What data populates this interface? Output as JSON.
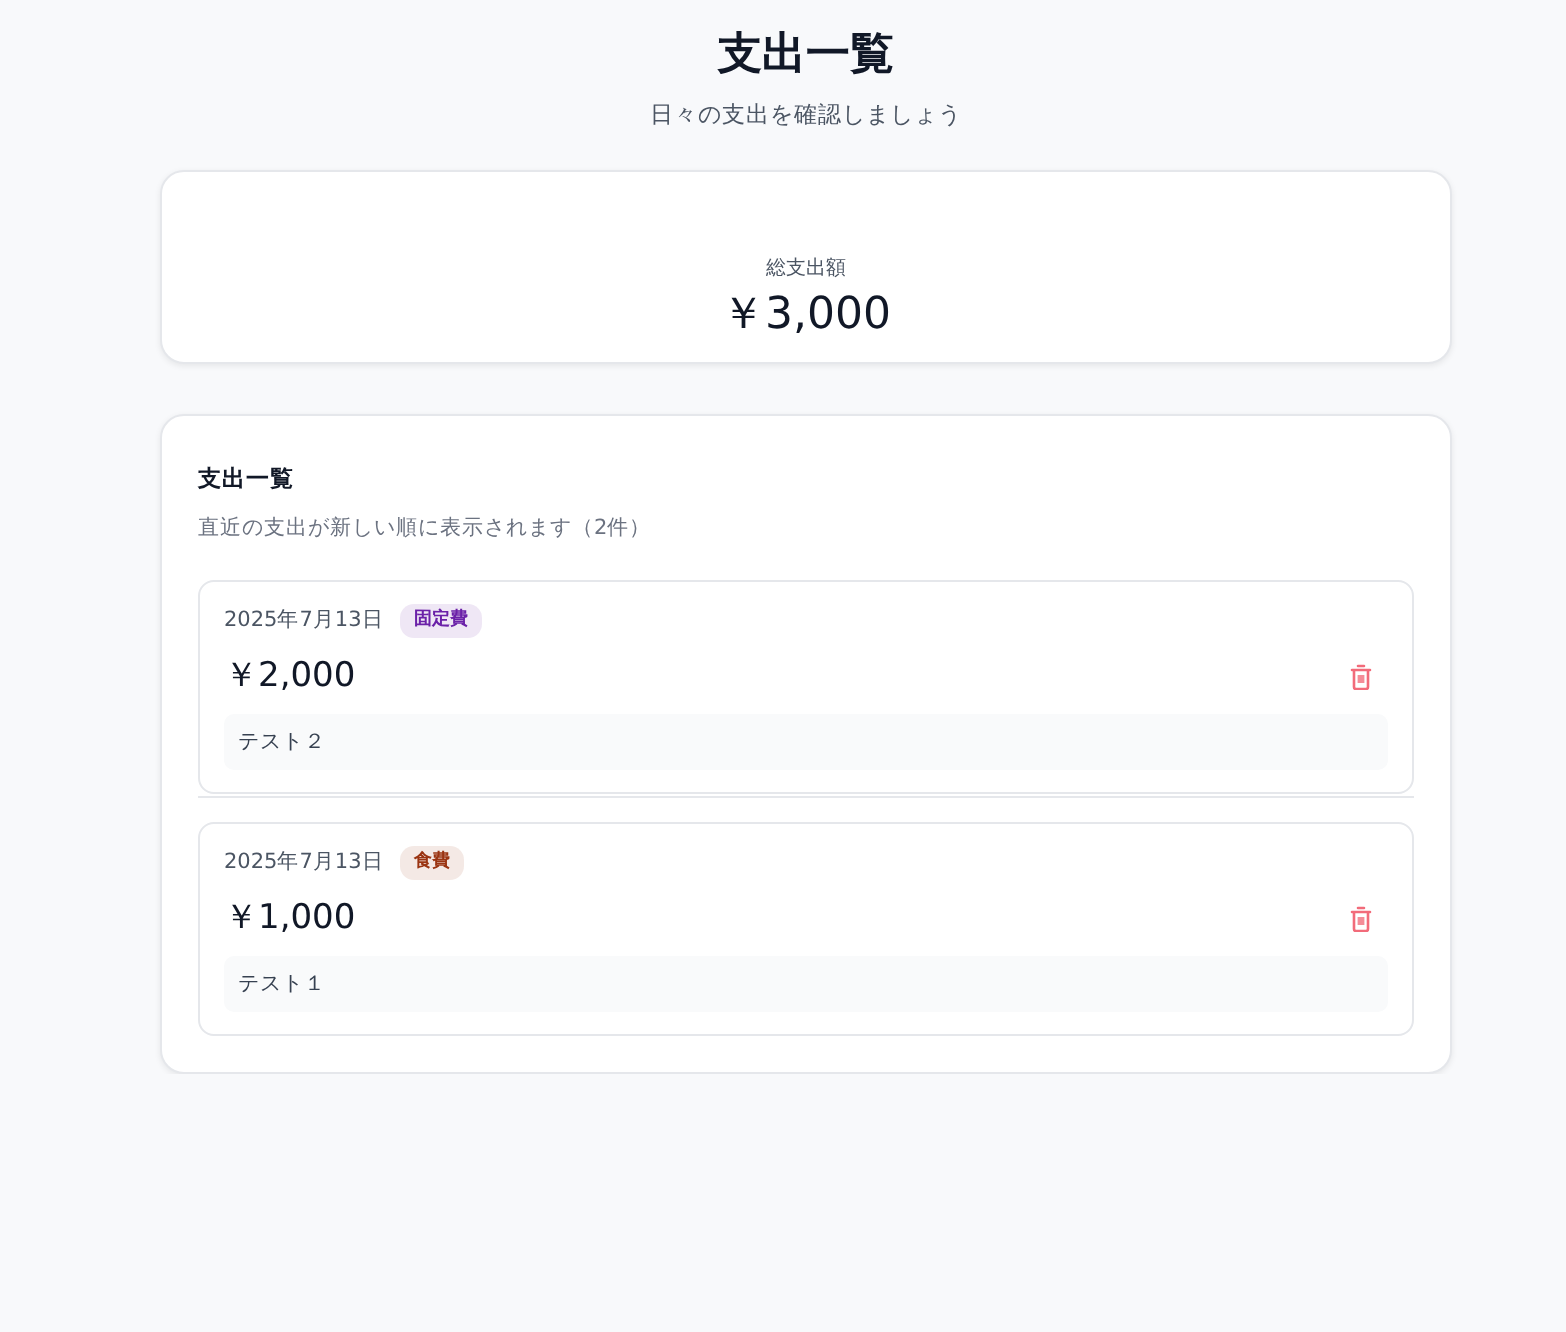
{
  "header": {
    "title": "支出一覧",
    "subtitle": "日々の支出を確認しましょう"
  },
  "summary": {
    "label": "総支出額",
    "amount": "￥3,000"
  },
  "list": {
    "title": "支出一覧",
    "description": "直近の支出が新しい順に表示されます（2件）",
    "items": [
      {
        "date": "2025年7月13日",
        "category": "固定費",
        "color": "#6b21a8",
        "amount": "￥2,000",
        "note": "テスト２"
      },
      {
        "date": "2025年7月13日",
        "category": "食費",
        "color": "#9a3412",
        "amount": "￥1,000",
        "note": "テスト１"
      }
    ]
  }
}
